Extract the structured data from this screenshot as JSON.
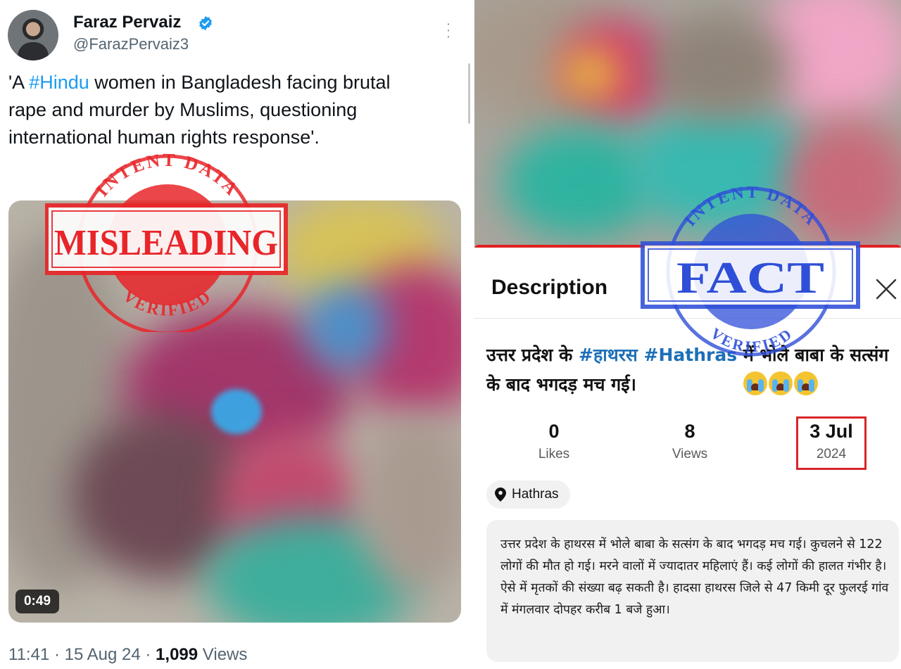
{
  "tweet": {
    "display_name": "Faraz Pervaiz",
    "handle": "@FarazPervaiz3",
    "text_before": "'A ",
    "hashtag": "#Hindu",
    "text_after": " women in Bangladesh facing brutal rape and murder by Muslims, questioning international human rights response'.",
    "video_duration": "0:49",
    "time": "11:41",
    "date": "15 Aug 24",
    "views_count": "1,099",
    "views_label": "Views",
    "sep": " · "
  },
  "stamp_left": {
    "top_text": "INTENT DATA",
    "bottom_text": "VERIFIED",
    "verdict": "MISLEADING",
    "color": "#e8262a"
  },
  "stamp_right": {
    "top_text": "INTENT DATA",
    "bottom_text": "VERIFIED",
    "verdict": "FACT",
    "color": "#2f4fd8"
  },
  "post": {
    "title": "Description",
    "headline_part1": "उत्तर प्रदेश के ",
    "hashtag1": "#हाथरस",
    "hashtag2": "#Hathras",
    "headline_part2": " में भोले बाबा के सत्संग के बाद भगदड़ मच गई।",
    "emoji": "sob-emoji x3",
    "stats": [
      {
        "value": "0",
        "label": "Likes"
      },
      {
        "value": "8",
        "label": "Views"
      },
      {
        "value": "3 Jul",
        "label": "2024"
      }
    ],
    "location": "Hathras",
    "body": "उत्तर प्रदेश के हाथरस में भोले बाबा के सत्संग के बाद भगदड़ मच गई। कुचलने से 122 लोगों की मौत हो गई। मरने वालों में ज्यादातर महिलाएं हैं। कई लोगों की हालत गंभीर है। ऐसे में मृतकों की संख्या बढ़ सकती है। हादसा हाथरस जिले से 47 किमी दूर फुलरई गांव में मंगलवार दोपहर करीब 1 बजे हुआ।"
  },
  "colors": {
    "link_blue": "#1d9bf0",
    "muted_gray": "#536471",
    "highlight_red": "#d8262c"
  }
}
